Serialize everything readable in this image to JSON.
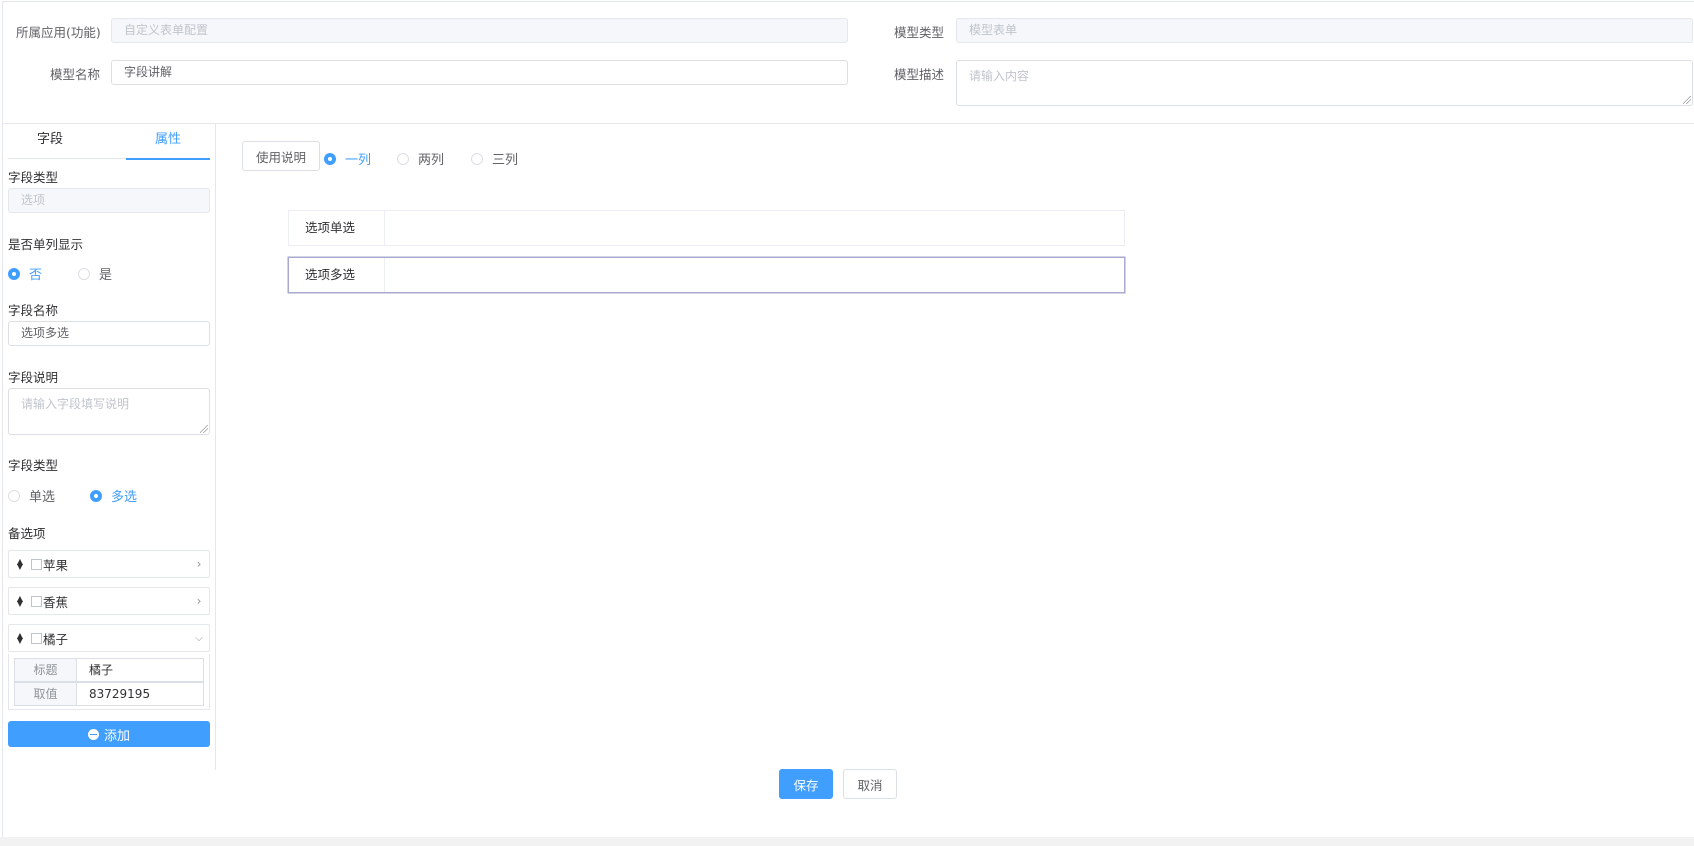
{
  "header": {
    "app_label": "所属应用(功能)",
    "app_value": "自定义表单配置",
    "model_type_label": "模型类型",
    "model_type_value": "模型表单",
    "model_name_label": "模型名称",
    "model_name_value": "字段讲解",
    "model_desc_label": "模型描述",
    "model_desc_placeholder": "请输入内容"
  },
  "sidebar": {
    "tabs": [
      {
        "label": "字段",
        "active": false
      },
      {
        "label": "属性",
        "active": true
      }
    ],
    "field_type_label": "字段类型",
    "field_type_value": "选项",
    "single_col_label": "是否单列显示",
    "single_col_options": [
      "否",
      "是"
    ],
    "single_col_selected": "否",
    "field_name_label": "字段名称",
    "field_name_value": "选项多选",
    "field_desc_label": "字段说明",
    "field_desc_placeholder": "请输入字段填写说明",
    "select_type_label": "字段类型",
    "select_type_options": [
      "单选",
      "多选"
    ],
    "select_type_selected": "多选",
    "options_label": "备选项",
    "options": [
      {
        "text": "苹果",
        "expanded": false
      },
      {
        "text": "香蕉",
        "expanded": false
      },
      {
        "text": "橘子",
        "expanded": true
      }
    ],
    "expanded_option": {
      "title_label": "标题",
      "title_value": "橘子",
      "value_label": "取值",
      "value_value": "83729195"
    },
    "add_button": "添加"
  },
  "canvas": {
    "usage_button": "使用说明",
    "columns_options": [
      "一列",
      "两列",
      "三列"
    ],
    "columns_selected": "一列",
    "fields": [
      {
        "label": "选项单选",
        "selected": false
      },
      {
        "label": "选项多选",
        "selected": true
      }
    ]
  },
  "footer": {
    "save_button": "保存",
    "cancel_button": "取消"
  },
  "colors": {
    "primary": "#409eff",
    "border": "#dcdfe6",
    "selected_field_border": "#a9a9cf"
  }
}
